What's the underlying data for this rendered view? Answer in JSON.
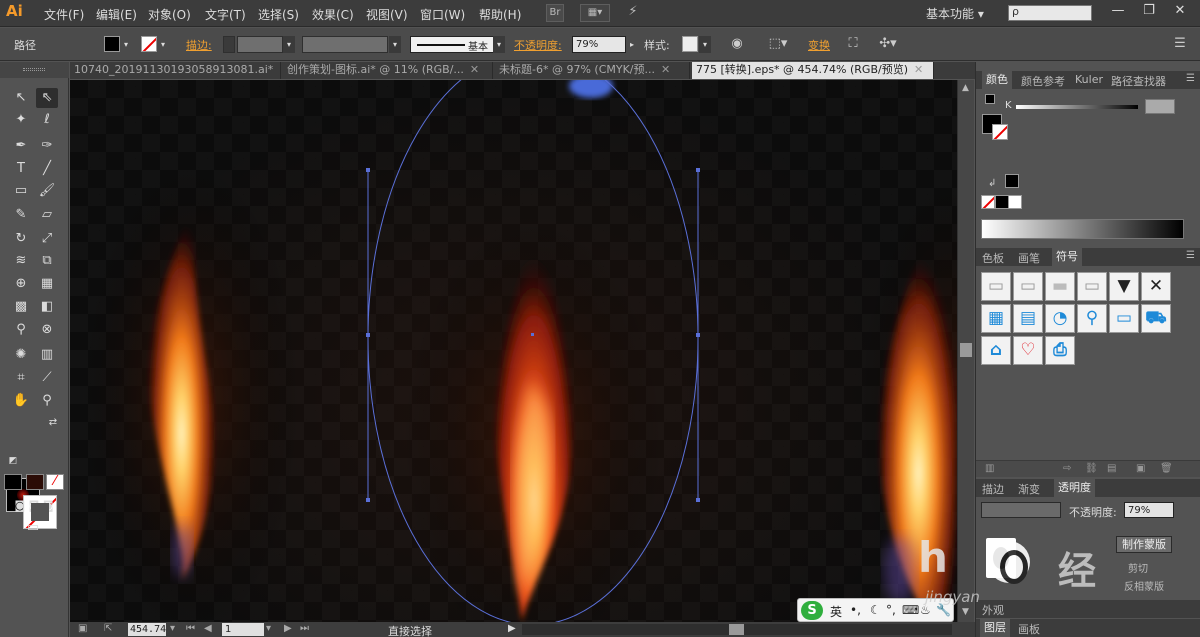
{
  "menubar": {
    "logo": "Ai",
    "items": [
      "文件(F)",
      "编辑(E)",
      "对象(O)",
      "文字(T)",
      "选择(S)",
      "效果(C)",
      "视图(V)",
      "窗口(W)",
      "帮助(H)"
    ],
    "bridge_label": "Br",
    "workspace": "基本功能",
    "search_placeholder": "ρ",
    "window_controls": [
      "—",
      "❐",
      "✕"
    ]
  },
  "controlbar": {
    "object_type": "路径",
    "stroke_label": "描边:",
    "stroke_style": "基本",
    "opacity_label": "不透明度:",
    "opacity_value": "79%",
    "style_label": "样式:",
    "transform_label": "变换"
  },
  "tabs": [
    {
      "label": "10740_20191130193058913081.ai*",
      "close": "✕",
      "active": false
    },
    {
      "label": "创作策划-图标.ai* @ 11% (RGB/...",
      "close": "✕",
      "active": false
    },
    {
      "label": "未标题-6* @ 97% (CMYK/预...",
      "close": "✕",
      "active": false
    },
    {
      "label": "775 [转换].eps* @ 454.74% (RGB/预览)",
      "close": "✕",
      "active": true
    }
  ],
  "statusbar": {
    "zoom": "454.74",
    "page": "1",
    "tool": "直接选择"
  },
  "panels": {
    "color_tabs": [
      "颜色",
      "颜色参考",
      "Kuler",
      "路径查找器"
    ],
    "color_k_label": "K",
    "swatch_tabs": [
      "色板",
      "画笔",
      "符号"
    ],
    "transparency_tabs": [
      "描边",
      "渐变",
      "透明度"
    ],
    "transparency_opacity_label": "不透明度:",
    "transparency_opacity_value": "79%",
    "make_mask_button": "制作蒙版",
    "clip_label": "剪切",
    "invert_label": "反相蒙版",
    "layer_tabs": [
      "图层",
      "画板"
    ],
    "appearance_tab": "外观"
  },
  "ime": {
    "lang": "英"
  },
  "watermark": {
    "brand_text": "经",
    "url": "jingyan"
  },
  "colors": {
    "accent_orange": "#f0a030",
    "selection_blue": "#5a6fd8",
    "flame_core": "#ffd26a",
    "flame_outer": "#e0400c"
  }
}
